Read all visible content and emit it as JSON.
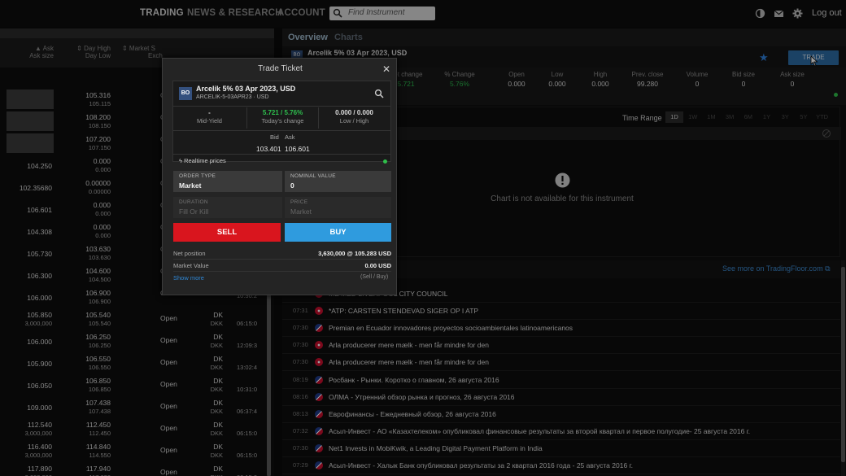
{
  "nav": {
    "trading": "TRADING",
    "news": "NEWS & RESEARCH",
    "account": "ACCOUNT",
    "search_placeholder": "Find Instrument",
    "logout": "Log out"
  },
  "left": {
    "headers": [
      {
        "h1": "▲ Ask",
        "h2": "Ask size"
      },
      {
        "h1": "⇕ Day High",
        "h2": "Day Low"
      },
      {
        "h1": "⇕ Market S",
        "h2": "Exch"
      }
    ],
    "rows": [
      {
        "bid": "",
        "v1": "105.316",
        "v2": "105.115",
        "status": "C",
        "cur": "",
        "cur2": "",
        "time": ""
      },
      {
        "bid": "",
        "v1": "108.200",
        "v2": "108.150",
        "status": "C",
        "cur": "",
        "cur2": "",
        "time": ""
      },
      {
        "bid": "",
        "v1": "107.200",
        "v2": "107.150",
        "status": "C",
        "cur": "",
        "cur2": "",
        "time": ""
      },
      {
        "bid": "104.250",
        "v1": "0.000",
        "v2": "0.000",
        "status": "C",
        "cur": "",
        "cur2": "",
        "time": ""
      },
      {
        "bid": "102.35680",
        "v1": "0.00000",
        "v2": "0.00000",
        "status": "C",
        "cur": "",
        "cur2": "",
        "time": ""
      },
      {
        "bid": "106.601",
        "v1": "0.000",
        "v2": "0.000",
        "status": "C",
        "cur": "",
        "cur2": "",
        "time": ""
      },
      {
        "bid": "104.308",
        "v1": "0.000",
        "v2": "0.000",
        "status": "C",
        "cur": "",
        "cur2": "",
        "time": ""
      },
      {
        "bid": "105.730",
        "v1": "103.630",
        "v2": "103.630",
        "status": "C",
        "cur": "",
        "cur2": "",
        "time": ""
      },
      {
        "bid": "106.300",
        "v1": "104.600",
        "v2": "104.500",
        "status": "C",
        "cur": "",
        "cur2": "",
        "time": ""
      },
      {
        "bid": "106.000",
        "v1": "106.900",
        "v2": "106.900",
        "status": "C",
        "cur": "",
        "cur2": "",
        "time": "10:30:2"
      },
      {
        "bid": "105.850",
        "bid2": "3,000,000",
        "v1": "105.540",
        "v2": "105.540",
        "status": "Open",
        "cur": "DK",
        "cur2": "DKK",
        "time": "06:15:0"
      },
      {
        "bid": "106.000",
        "v1": "106.250",
        "v2": "106.250",
        "status": "Open",
        "cur": "DK",
        "cur2": "DKK",
        "time": "12:09:3"
      },
      {
        "bid": "105.900",
        "v1": "106.550",
        "v2": "106.550",
        "status": "Open",
        "cur": "DK",
        "cur2": "DKK",
        "time": "13:02:4"
      },
      {
        "bid": "106.050",
        "v1": "106.850",
        "v2": "106.850",
        "status": "Open",
        "cur": "DK",
        "cur2": "DKK",
        "time": "10:31:0"
      },
      {
        "bid": "109.000",
        "v1": "107.438",
        "v2": "107.438",
        "status": "Open",
        "cur": "DK",
        "cur2": "DKK",
        "time": "06:37:4"
      },
      {
        "bid": "112.540",
        "bid2": "3,000,000",
        "v1": "112.450",
        "v2": "112.450",
        "status": "Open",
        "cur": "DK",
        "cur2": "DKK",
        "time": "06:15:0"
      },
      {
        "bid": "116.400",
        "bid2": "3,000,000",
        "v1": "114.840",
        "v2": "114.550",
        "status": "Open",
        "cur": "DK",
        "cur2": "DKK",
        "time": "06:15:0"
      },
      {
        "bid": "117.890",
        "bid2": "3,000,000",
        "v1": "117.940",
        "v2": "117.620",
        "status": "Open",
        "cur": "DK",
        "cur2": "DKK",
        "time": "06:15:0"
      }
    ]
  },
  "right": {
    "tabs": [
      "Overview",
      "Charts"
    ],
    "instrument_badge": "BO",
    "instrument_title": "Arcelik 5% 03 Apr 2023, USD",
    "trade_button": "TRADE",
    "stats": [
      {
        "label": "Net change",
        "value": "5.721",
        "green": true
      },
      {
        "label": "% Change",
        "value": "5.76%",
        "green": true
      },
      {
        "label": "Open",
        "value": "0.000"
      },
      {
        "label": "Low",
        "value": "0.000"
      },
      {
        "label": "High",
        "value": "0.000"
      },
      {
        "label": "Prev. close",
        "value": "99.280"
      },
      {
        "label": "Volume",
        "value": "0"
      },
      {
        "label": "Bid size",
        "value": "0"
      },
      {
        "label": "Ask size",
        "value": "0"
      }
    ],
    "time_range_label": "Time Range",
    "time_ranges": [
      "1D",
      "1W",
      "1M",
      "3M",
      "6M",
      "1Y",
      "3Y",
      "5Y",
      "YTD"
    ],
    "chart_message": "Chart is not available for this instrument",
    "see_more": "See more on TradingFloor.com",
    "news": [
      {
        "time": "",
        "flag": "dk",
        "text": "...E MED LIVERPOOL CITY COUNCIL"
      },
      {
        "time": "07:31",
        "flag": "dk",
        "text": "*ATP: CARSTEN STENDEVAD SIGER OP I ATP"
      },
      {
        "time": "07:30",
        "flag": "gb",
        "text": "Premian en Ecuador innovadores proyectos socioambientales latinoamericanos"
      },
      {
        "time": "07:30",
        "flag": "dk",
        "text": "Arla producerer mere mælk - men får mindre for den"
      },
      {
        "time": "07:30",
        "flag": "dk",
        "text": "Arla producerer mere mælk - men får mindre for den"
      },
      {
        "time": "08:19",
        "flag": "gb",
        "text": "Росбанк - Рынки. Коротко о главном, 26 августа 2016"
      },
      {
        "time": "08:16",
        "flag": "gb",
        "text": "ОЛМА - Утренний обзор рынка и прогноз, 26 августа 2016"
      },
      {
        "time": "08:13",
        "flag": "gb",
        "text": "Еврофинансы - Ежедневный обзор, 26 августа 2016"
      },
      {
        "time": "07:32",
        "flag": "gb",
        "text": "Асыл-Инвест - АО «Казахтелеком» опубликовал финансовые результаты за второй квартал и первое полугодие- 25 августа 2016 г."
      },
      {
        "time": "07:30",
        "flag": "gb",
        "text": "Net1 Invests in MobiKwik, a Leading Digital Payment Platform in India"
      },
      {
        "time": "07:29",
        "flag": "gb",
        "text": "Асыл-Инвест - Халык Банк опубликовал результаты за 2 квартал 2016 года - 25 августа 2016 г."
      }
    ]
  },
  "ticket": {
    "title": "Trade Ticket",
    "badge": "BO",
    "name": "Arcelik 5% 03 Apr 2023, USD",
    "code": "ARCELIK-5-03APR23 · USD",
    "mid_value": "-",
    "mid_label": "Mid-Yield",
    "change_value": "5.721 / 5.76%",
    "change_label": "Today's change",
    "lowhigh_value": "0.000 / 0.000",
    "lowhigh_label": "Low / High",
    "bid_label": "Bid",
    "ask_label": "Ask",
    "bid": "103.401",
    "ask": "106.601",
    "realtime": "Realtime prices",
    "order_type_label": "ORDER TYPE",
    "order_type": "Market",
    "nominal_label": "NOMINAL VALUE",
    "nominal": "0",
    "duration_label": "DURATION",
    "duration": "Fill Or Kill",
    "price_label": "PRICE",
    "price": "Market",
    "sell": "SELL",
    "buy": "BUY",
    "net_position_label": "Net position",
    "net_position": "3,630,000 @ 105.283 USD",
    "market_value_label": "Market Value",
    "market_value": "0.00 USD",
    "show_more": "Show more",
    "sell_buy_note": "(Sell / Buy)"
  }
}
